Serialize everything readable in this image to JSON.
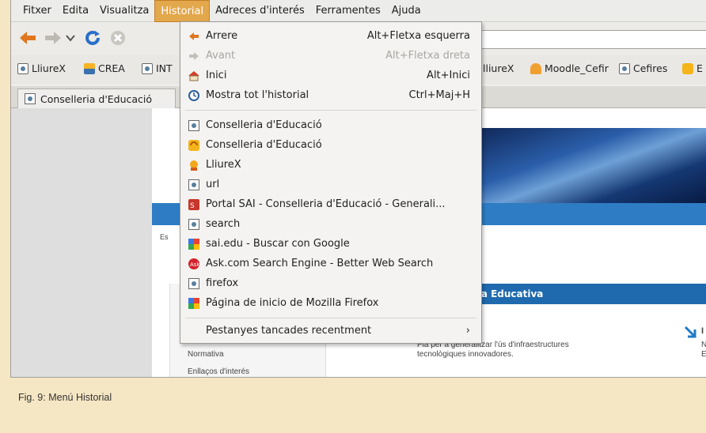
{
  "menubar": {
    "items": [
      "Fitxer",
      "Edita",
      "Visualitza",
      "Historial",
      "Adreces d'interés",
      "Ferramentes",
      "Ajuda"
    ],
    "active": "Historial"
  },
  "bookmarks": [
    "LliureX",
    "CREA",
    "INT",
    "lliureX",
    "Moodle_Cefir",
    "Cefires",
    "E"
  ],
  "tab": {
    "title": "Conselleria d'Educació"
  },
  "page": {
    "left_fragment": "Es",
    "section_title": "gica Educativa",
    "side_items": [
      "Normativa",
      "Enllaços d'interés"
    ],
    "text_line1": "Pla per a generalitzar l'ús d'infraestructures",
    "text_line2": "tecnològiques innovadores.",
    "right_letters": [
      "I",
      "N",
      "E"
    ]
  },
  "historial_menu": {
    "back": {
      "label": "Arrere",
      "shortcut": "Alt+Fletxa esquerra"
    },
    "forward": {
      "label": "Avant",
      "shortcut": "Alt+Fletxa dreta"
    },
    "home": {
      "label": "Inici",
      "shortcut": "Alt+Inici"
    },
    "show_all": {
      "label": "Mostra tot l'historial",
      "shortcut": "Ctrl+Maj+H"
    },
    "entries": [
      {
        "label": "Conselleria d'Educació",
        "icon": "page-icon"
      },
      {
        "label": "Conselleria d'Educació",
        "icon": "orange-globe-icon"
      },
      {
        "label": "LliureX",
        "icon": "lliurex-icon"
      },
      {
        "label": "url",
        "icon": "page-icon"
      },
      {
        "label": "Portal SAI - Conselleria d'Educació - Generali...",
        "icon": "sai-icon"
      },
      {
        "label": "search",
        "icon": "page-icon"
      },
      {
        "label": "sai.edu - Buscar con Google",
        "icon": "google-icon"
      },
      {
        "label": "Ask.com Search Engine - Better Web Search",
        "icon": "ask-icon"
      },
      {
        "label": "firefox",
        "icon": "page-icon"
      },
      {
        "label": "Página de inicio de Mozilla Firefox",
        "icon": "google-icon"
      }
    ],
    "recently_closed": {
      "label": "Pestanyes tancades recentment",
      "arrow": "›"
    }
  },
  "caption": "Fig. 9: Menú Historial"
}
